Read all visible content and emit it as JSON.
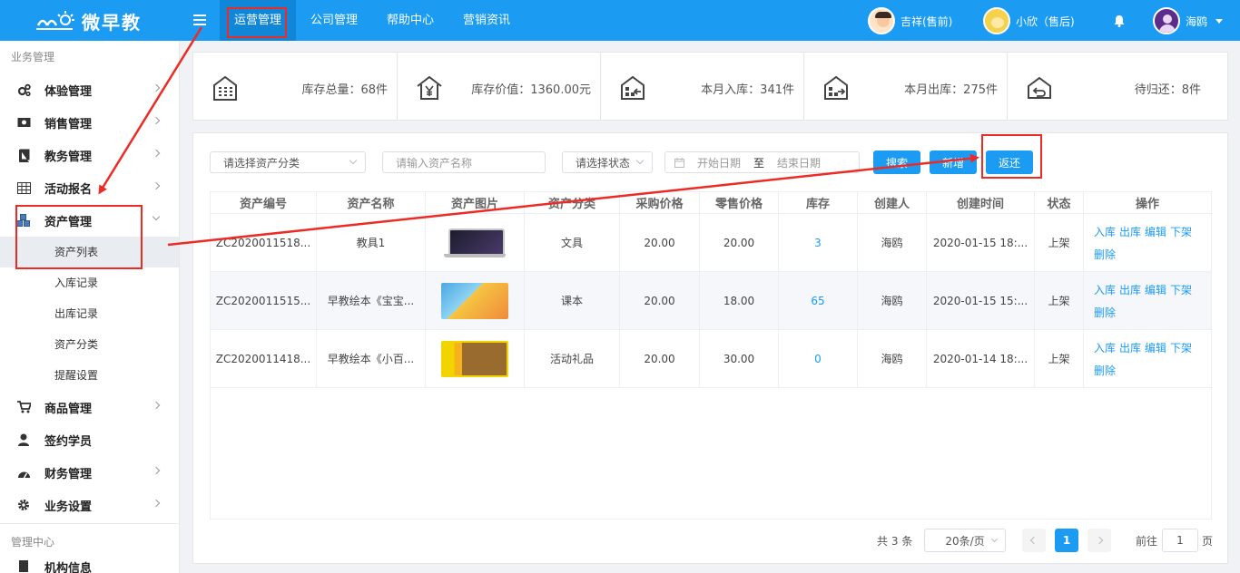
{
  "header": {
    "logo_text": "微早教",
    "nav": [
      "运营管理",
      "公司管理",
      "帮助中心",
      "营销资讯"
    ],
    "users": [
      "吉祥(售前)",
      "小欣（售后)",
      "海鸥"
    ]
  },
  "sidebar": {
    "section1": "业务管理",
    "items": [
      {
        "label": "体验管理",
        "icon": "gears-icon"
      },
      {
        "label": "销售管理",
        "icon": "money-icon"
      },
      {
        "label": "教务管理",
        "icon": "book-icon"
      },
      {
        "label": "活动报名",
        "icon": "table-icon"
      },
      {
        "label": "资产管理",
        "icon": "cubes-icon"
      }
    ],
    "sub_items": [
      "资产列表",
      "入库记录",
      "出库记录",
      "资产分类",
      "提醒设置"
    ],
    "items2": [
      {
        "label": "商品管理",
        "icon": "cart-icon"
      },
      {
        "label": "签约学员",
        "icon": "user-icon"
      },
      {
        "label": "财务管理",
        "icon": "dashboard-icon"
      },
      {
        "label": "业务设置",
        "icon": "gear-icon"
      }
    ],
    "section2": "管理中心",
    "partial_item": "机构信息"
  },
  "stats": [
    {
      "text": "库存总量：68件",
      "icon": "building-icon"
    },
    {
      "text": "库存价值：1360.00元",
      "icon": "yen-house-icon"
    },
    {
      "text": "本月入库：341件",
      "icon": "warehouse-in-icon"
    },
    {
      "text": "本月出库：275件",
      "icon": "warehouse-out-icon"
    },
    {
      "text": "待归还：8件",
      "icon": "return-icon"
    }
  ],
  "filters": {
    "category_placeholder": "请选择资产分类",
    "name_placeholder": "请输入资产名称",
    "status_placeholder": "请选择状态",
    "start_date": "开始日期",
    "to": "至",
    "end_date": "结束日期",
    "search_btn": "搜索",
    "add_btn": "新增",
    "return_btn": "返还"
  },
  "table": {
    "columns": [
      "资产编号",
      "资产名称",
      "资产图片",
      "资产分类",
      "采购价格",
      "零售价格",
      "库存",
      "创建人",
      "创建时间",
      "状态",
      "操作"
    ],
    "rows": [
      {
        "code": "ZC2020011518...",
        "name": "教具1",
        "image": "laptop",
        "category": "文具",
        "purchase": "20.00",
        "retail": "20.00",
        "stock": "3",
        "creator": "海鸥",
        "created": "2020-01-15 18:...",
        "status": "上架"
      },
      {
        "code": "ZC2020011515...",
        "name": "早教绘本《宝宝...",
        "image": "book-set",
        "category": "课本",
        "purchase": "20.00",
        "retail": "18.00",
        "stock": "65",
        "creator": "海鸥",
        "created": "2020-01-15 15:...",
        "status": "上架"
      },
      {
        "code": "ZC2020011418...",
        "name": "早教绘本《小百...",
        "image": "lion-books",
        "category": "活动礼品",
        "purchase": "20.00",
        "retail": "30.00",
        "stock": "0",
        "creator": "海鸥",
        "created": "2020-01-14 18:...",
        "status": "上架"
      }
    ],
    "ops": [
      "入库",
      "出库",
      "编辑",
      "下架",
      "删除"
    ]
  },
  "pagination": {
    "total": "共 3 条",
    "page_size": "20条/页",
    "current": "1",
    "goto_prefix": "前往",
    "goto_value": "1",
    "goto_suffix": "页"
  },
  "colors": {
    "primary": "#1b9cf2",
    "annotation": "#ee2a24"
  }
}
